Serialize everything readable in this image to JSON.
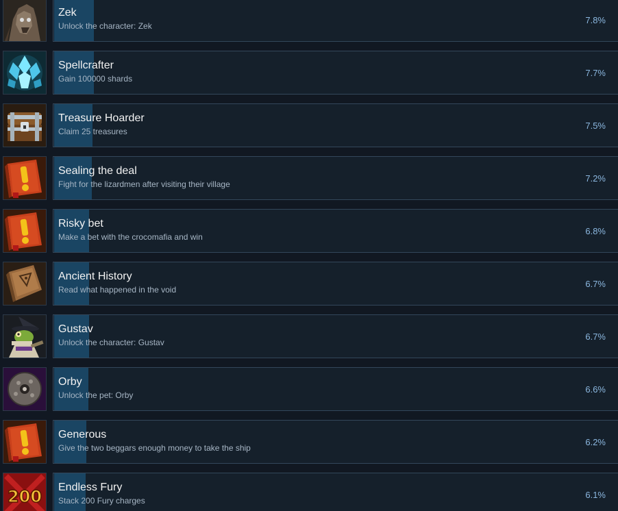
{
  "achievements": [
    {
      "title": "Zek",
      "description": "Unlock the character: Zek",
      "percent": "7.8%",
      "icon": "zek-portrait-icon"
    },
    {
      "title": "Spellcrafter",
      "description": "Gain 100000 shards",
      "percent": "7.7%",
      "icon": "crystal-shards-icon"
    },
    {
      "title": "Treasure Hoarder",
      "description": "Claim 25 treasures",
      "percent": "7.5%",
      "icon": "treasure-chest-icon"
    },
    {
      "title": "Sealing the deal",
      "description": "Fight for the lizardmen after visiting their village",
      "percent": "7.2%",
      "icon": "exclamation-book-icon"
    },
    {
      "title": "Risky bet",
      "description": "Make a bet with the crocomafia and win",
      "percent": "6.8%",
      "icon": "exclamation-book-icon"
    },
    {
      "title": "Ancient History",
      "description": "Read what happened in the void",
      "percent": "6.7%",
      "icon": "ancient-book-icon"
    },
    {
      "title": "Gustav",
      "description": "Unlock the character: Gustav",
      "percent": "6.7%",
      "icon": "gustav-portrait-icon"
    },
    {
      "title": "Orby",
      "description": "Unlock the pet: Orby",
      "percent": "6.6%",
      "icon": "orb-pet-icon"
    },
    {
      "title": "Generous",
      "description": "Give the two beggars enough money to take the ship",
      "percent": "6.2%",
      "icon": "exclamation-book-icon"
    },
    {
      "title": "Endless Fury",
      "description": "Stack 200 Fury charges",
      "percent": "6.1%",
      "icon": "fury-200-icon",
      "icon_text": "200"
    }
  ],
  "colors": {
    "background": "#111822",
    "card": "#15202b",
    "progress_fill": "#1a4563",
    "percent_text": "#8cb8e0"
  }
}
